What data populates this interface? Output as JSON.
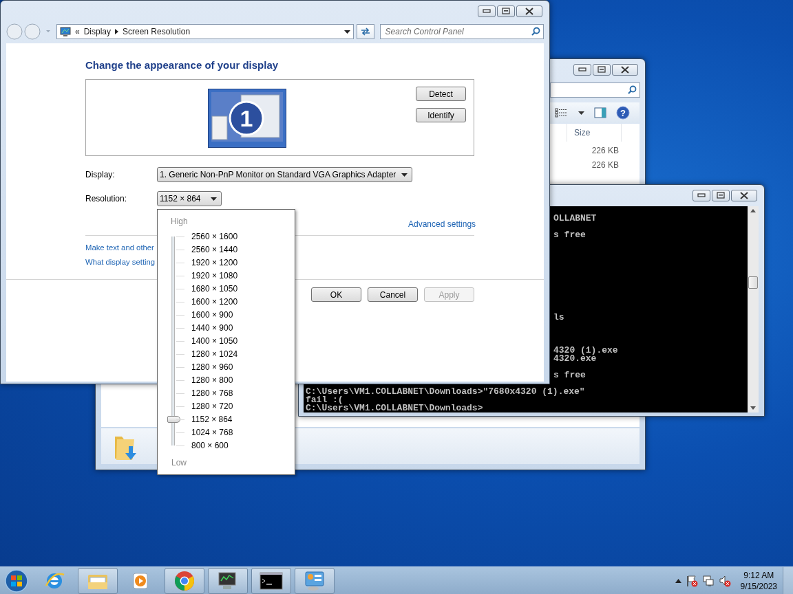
{
  "control_panel": {
    "breadcrumb_prefix": "«",
    "breadcrumb": [
      "Display",
      "Screen Resolution"
    ],
    "search_placeholder": "Search Control Panel",
    "heading": "Change the appearance of your display",
    "monitor_number": "1",
    "side_buttons": [
      "Detect",
      "Identify"
    ],
    "display_label": "Display:",
    "display_value": "1. Generic Non-PnP Monitor on Standard VGA Graphics Adapter",
    "resolution_label": "Resolution:",
    "resolution_value": "1152 × 864",
    "advanced_link": "Advanced settings",
    "links": [
      "Make text and other",
      "What display setting"
    ],
    "buttons": [
      {
        "label": "OK",
        "disabled": false
      },
      {
        "label": "Cancel",
        "disabled": false
      },
      {
        "label": "Apply",
        "disabled": true
      }
    ]
  },
  "resolution_popup": {
    "high_label": "High",
    "low_label": "Low",
    "level": 0.125,
    "options": [
      "2560 × 1600",
      "2560 × 1440",
      "1920 × 1200",
      "1920 × 1080",
      "1680 × 1050",
      "1600 × 1200",
      "1600 × 900",
      "1440 × 900",
      "1400 × 1050",
      "1280 × 1024",
      "1280 × 960",
      "1280 × 800",
      "1280 × 768",
      "1280 × 720",
      "1152 × 864",
      "1024 × 768",
      "800 × 600"
    ]
  },
  "explorer": {
    "help_glyph": "?",
    "column": "Size",
    "sizes": [
      "226 KB",
      "226 KB"
    ]
  },
  "console": {
    "fragments": [
      "OLLABNET",
      "s free",
      "ls",
      "4320 (1).exe",
      "4320.exe",
      "s free"
    ],
    "lines": [
      "C:\\Users\\VM1.COLLABNET\\Downloads>\"7680x4320 (1).exe\"",
      "fail :(",
      "C:\\Users\\VM1.COLLABNET\\Downloads>"
    ]
  },
  "taskbar": {
    "items": [
      {
        "kind": "ie",
        "running": false
      },
      {
        "kind": "explorer",
        "running": true
      },
      {
        "kind": "media",
        "running": false
      },
      {
        "kind": "chrome",
        "running": true
      },
      {
        "kind": "monitor",
        "running": true
      },
      {
        "kind": "cmd",
        "running": true
      },
      {
        "kind": "control",
        "running": true
      }
    ],
    "time": "9:12 AM",
    "date": "9/15/2023"
  }
}
